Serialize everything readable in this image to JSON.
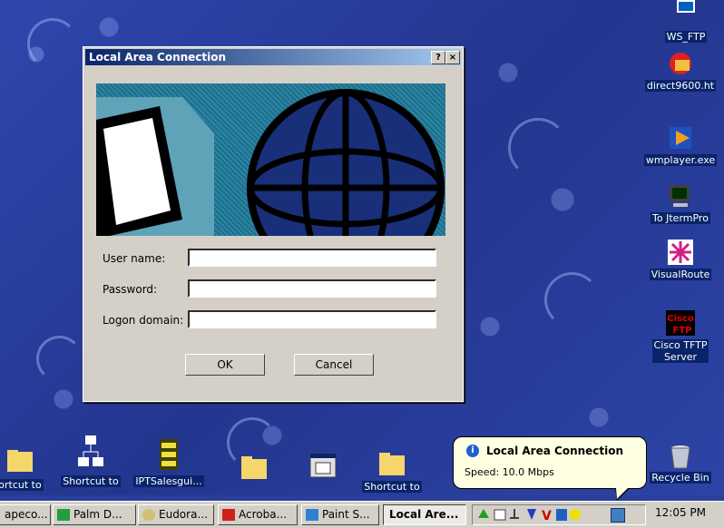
{
  "dialog": {
    "title": "Local Area Connection",
    "help_button": "?",
    "close_button": "×",
    "fields": [
      {
        "label": "User name:",
        "value": ""
      },
      {
        "label": "Password:",
        "value": ""
      },
      {
        "label": "Logon domain:",
        "value": ""
      }
    ],
    "ok_label": "OK",
    "cancel_label": "Cancel"
  },
  "desktop_icons_right": [
    {
      "label": "WS_FTP",
      "icon": "ftp-icon"
    },
    {
      "label": "direct9600.ht",
      "icon": "browser-document-icon"
    },
    {
      "label": "wmplayer.exe",
      "icon": "media-player-icon"
    },
    {
      "label": "To JtermPro",
      "icon": "terminal-icon"
    },
    {
      "label": "VisualRoute",
      "icon": "visualroute-icon"
    },
    {
      "label": "Cisco TFTP\nServer",
      "icon": "cisco-tftp-icon"
    },
    {
      "label": "Recycle Bin",
      "icon": "recycle-bin-icon"
    }
  ],
  "desktop_icons_bottom": [
    {
      "label": "ortcut to",
      "icon": "folder-icon"
    },
    {
      "label": "Shortcut to",
      "icon": "network-icon"
    },
    {
      "label": "IPTSalesgui...",
      "icon": "archive-icon"
    },
    {
      "label": "",
      "icon": "folder-icon"
    },
    {
      "label": "",
      "icon": "window-icon"
    },
    {
      "label": "Shortcut to",
      "icon": "folder-icon"
    }
  ],
  "balloon": {
    "title": "Local Area Connection",
    "text": "Speed: 10.0 Mbps"
  },
  "taskbar": {
    "items": [
      {
        "label": "apeco...",
        "icon": "app-icon"
      },
      {
        "label": "Palm D...",
        "icon": "palm-icon"
      },
      {
        "label": "Eudora...",
        "icon": "eudora-icon"
      },
      {
        "label": "Acroba...",
        "icon": "acrobat-icon"
      },
      {
        "label": "Paint S...",
        "icon": "paint-icon"
      },
      {
        "label": "Local Are...",
        "icon": "network-icon"
      }
    ],
    "clock": "12:05 PM"
  },
  "colors": {
    "desktop": "#2a3f9a",
    "titlebar_start": "#0a246a",
    "titlebar_end": "#a6caf0",
    "dialog_face": "#d4d0c8",
    "balloon_bg": "#ffffe1"
  }
}
